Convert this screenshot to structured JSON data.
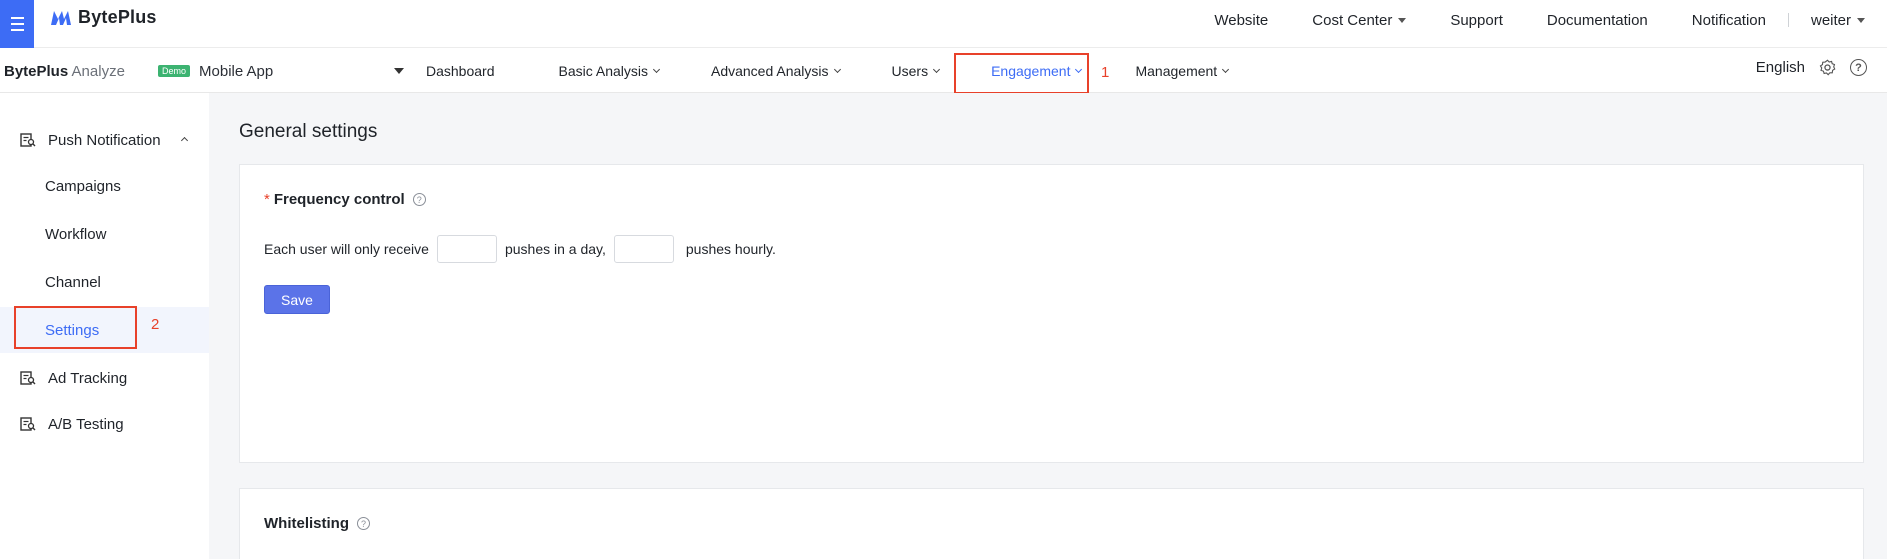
{
  "topbar": {
    "brand": "BytePlus",
    "links": [
      {
        "label": "Website",
        "dropdown": false
      },
      {
        "label": "Cost Center",
        "dropdown": true
      },
      {
        "label": "Support",
        "dropdown": false
      },
      {
        "label": "Documentation",
        "dropdown": false
      },
      {
        "label": "Notification",
        "dropdown": false
      }
    ],
    "user": "weiter"
  },
  "navbar": {
    "product_bold": "BytePlus",
    "product_light": "Analyze",
    "demo_badge": "Demo",
    "app_name": "Mobile App",
    "menu": [
      {
        "label": "Dashboard",
        "dropdown": false
      },
      {
        "label": "Basic Analysis",
        "dropdown": true
      },
      {
        "label": "Advanced Analysis",
        "dropdown": true
      },
      {
        "label": "Users",
        "dropdown": true
      },
      {
        "label": "Engagement",
        "dropdown": true,
        "active": true
      },
      {
        "label": "Management",
        "dropdown": true
      }
    ],
    "language": "English"
  },
  "annotations": {
    "marker1": "1",
    "marker2": "2"
  },
  "sidebar": {
    "group_push": "Push Notification",
    "sub_items": [
      "Campaigns",
      "Workflow",
      "Channel",
      "Settings"
    ],
    "active_sub": "Settings",
    "group_ad": "Ad Tracking",
    "group_ab": "A/B Testing"
  },
  "main": {
    "title": "General settings",
    "frequency": {
      "title": "Frequency control",
      "required_mark": "*",
      "text_before": "Each user will only receive",
      "text_middle": "pushes in a day,",
      "text_after": "pushes hourly.",
      "daily_value": "",
      "hourly_value": "",
      "save_label": "Save"
    },
    "whitelisting": {
      "title": "Whitelisting"
    }
  },
  "colors": {
    "accent": "#3d6cf5",
    "highlight": "#e8412a",
    "save_button": "#5b73e8",
    "demo_badge": "#3cb371"
  }
}
